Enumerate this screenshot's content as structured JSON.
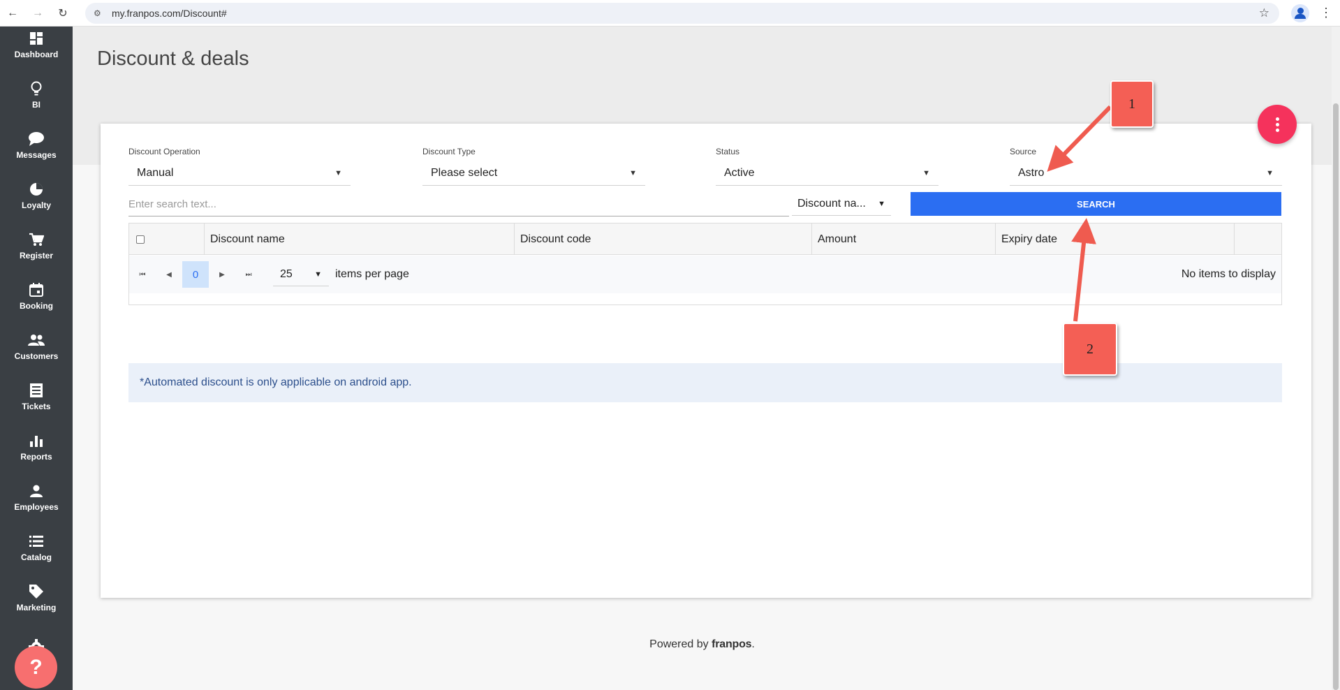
{
  "browser": {
    "url": "my.franpos.com/Discount#"
  },
  "sidebar": {
    "items": [
      {
        "label": "Dashboard",
        "icon": "dashboard-icon"
      },
      {
        "label": "BI",
        "icon": "lightbulb-icon"
      },
      {
        "label": "Messages",
        "icon": "chat-bubble-icon"
      },
      {
        "label": "Loyalty",
        "icon": "pie-chart-icon"
      },
      {
        "label": "Register",
        "icon": "cart-icon"
      },
      {
        "label": "Booking",
        "icon": "calendar-icon"
      },
      {
        "label": "Customers",
        "icon": "people-icon"
      },
      {
        "label": "Tickets",
        "icon": "receipt-icon"
      },
      {
        "label": "Reports",
        "icon": "bar-chart-icon"
      },
      {
        "label": "Employees",
        "icon": "person-icon"
      },
      {
        "label": "Catalog",
        "icon": "list-icon"
      },
      {
        "label": "Marketing",
        "icon": "tag-icon"
      }
    ],
    "help_label": "?"
  },
  "page": {
    "title": "Discount & deals"
  },
  "filters": {
    "operation": {
      "label": "Discount Operation",
      "value": "Manual"
    },
    "type": {
      "label": "Discount Type",
      "value": "Please select"
    },
    "status": {
      "label": "Status",
      "value": "Active"
    },
    "source": {
      "label": "Source",
      "value": "Astro"
    }
  },
  "search": {
    "placeholder": "Enter search text...",
    "by": "Discount na...",
    "button": "SEARCH"
  },
  "grid": {
    "columns": [
      "Discount name",
      "Discount code",
      "Amount",
      "Expiry date"
    ],
    "page_current": "0",
    "page_size": "25",
    "page_size_label": "items per page",
    "empty_message": "No items to display"
  },
  "note": "*Automated discount is only applicable on android app.",
  "footer": {
    "prefix": "Powered by",
    "brand": "franpos",
    "suffix": "."
  },
  "annotations": [
    {
      "label": "1"
    },
    {
      "label": "2"
    }
  ],
  "colors": {
    "sidebar": "#3a3f44",
    "primary": "#2b6ef2",
    "fab": "#f5325c",
    "help": "#f76f6f",
    "annotation": "#f45f55"
  }
}
